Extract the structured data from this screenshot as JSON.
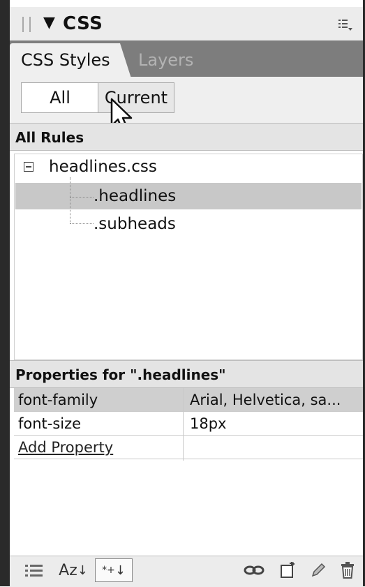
{
  "panel": {
    "title": "CSS",
    "collapse_glyph": "▼",
    "options_icon": "panel-options-icon"
  },
  "tabs": [
    {
      "label": "CSS Styles",
      "active": true
    },
    {
      "label": "Layers",
      "active": false
    }
  ],
  "mode_buttons": {
    "all_label": "All",
    "current_label": "Current"
  },
  "rules": {
    "heading": "All Rules",
    "stylesheet": "headlines.css",
    "items": [
      {
        "label": ".headlines",
        "selected": true
      },
      {
        "label": ".subheads",
        "selected": false
      }
    ]
  },
  "properties": {
    "heading": "Properties for \".headlines\"",
    "rows": [
      {
        "name": "font-family",
        "value": "Arial, Helvetica, sa..."
      },
      {
        "name": "font-size",
        "value": "18px"
      }
    ],
    "add_label": "Add Property"
  },
  "bottom_toolbar": {
    "sort_az_label": "Az",
    "icons": [
      "category-view-icon",
      "alpha-sort-icon",
      "set-properties-icon",
      "attach-stylesheet-icon",
      "new-css-rule-icon",
      "edit-style-icon",
      "delete-icon"
    ]
  },
  "colors": {
    "selection": "#c8c8c8",
    "tab_strip": "#7d7d7d",
    "panel_bg": "#efefef"
  }
}
